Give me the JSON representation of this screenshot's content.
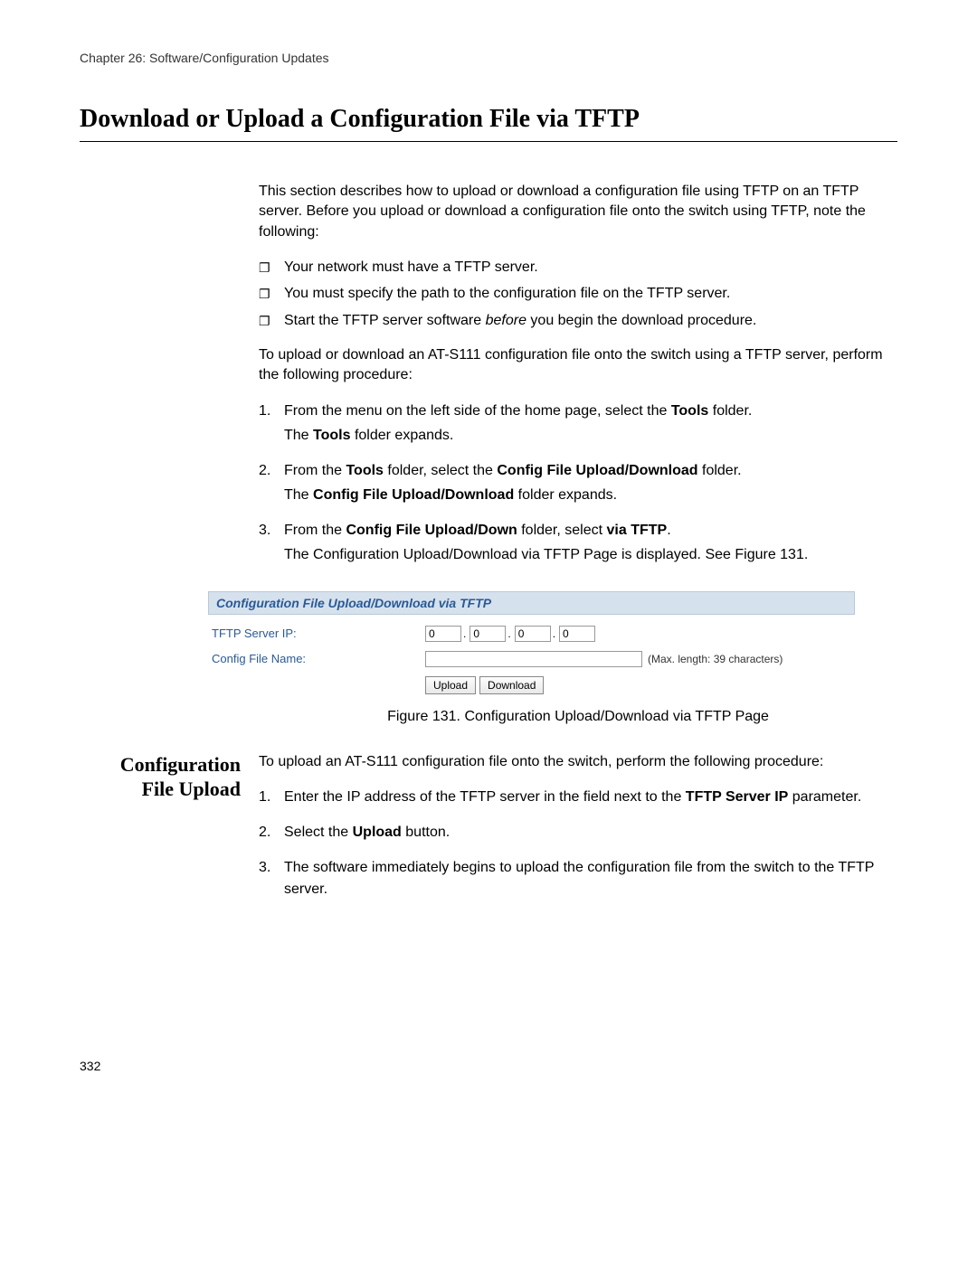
{
  "chapter_header": "Chapter 26: Software/Configuration Updates",
  "main_title": "Download or Upload a Configuration File via TFTP",
  "intro_para": "This section describes how to upload or download a configuration file using TFTP on an TFTP server. Before you upload or download a configuration file onto the switch using TFTP, note the following:",
  "bullets": {
    "b1": "Your network must have a TFTP server.",
    "b2": "You must specify the path to the configuration file on the TFTP server.",
    "b3a": "Start the TFTP server software ",
    "b3b": "before",
    "b3c": " you begin the download procedure."
  },
  "lead_para": "To upload or download an AT-S111 configuration file onto the switch using a TFTP server, perform the following procedure:",
  "steps1": {
    "s1": {
      "num": "1.",
      "a": "From the menu on the left side of the home page, select the ",
      "b": "Tools",
      "c": " folder.",
      "d": "The ",
      "e": "Tools",
      "f": " folder expands."
    },
    "s2": {
      "num": "2.",
      "a": "From the ",
      "b": "Tools",
      "c": " folder, select the ",
      "d": "Config File Upload/Download",
      "e": " folder.",
      "f": "The ",
      "g": "Config File Upload/Download",
      "h": " folder expands."
    },
    "s3": {
      "num": "3.",
      "a": "From the ",
      "b": "Config File Upload/Down",
      "c": " folder, select ",
      "d": "via TFTP",
      "e": ".",
      "f": "The Configuration Upload/Download via TFTP Page is displayed. See Figure 131."
    }
  },
  "panel": {
    "header": "Configuration File Upload/Download via TFTP",
    "label_ip": "TFTP Server IP:",
    "label_name": "Config File Name:",
    "ip": {
      "o1": "0",
      "o2": "0",
      "o3": "0",
      "o4": "0"
    },
    "maxnote": "(Max. length: 39 characters)",
    "btn_upload": "Upload",
    "btn_download": "Download"
  },
  "fig_caption": "Figure 131. Configuration Upload/Download via TFTP Page",
  "side_heading_line1": "Configuration",
  "side_heading_line2": "File Upload",
  "upload_intro": "To upload an AT-S111 configuration file onto the switch, perform the following procedure:",
  "steps2": {
    "s1": {
      "num": "1.",
      "a": "Enter the IP address of the TFTP server in the field next to the ",
      "b": "TFTP Server IP",
      "c": " parameter."
    },
    "s2": {
      "num": "2.",
      "a": "Select the ",
      "b": "Upload",
      "c": " button."
    },
    "s3": {
      "num": "3.",
      "a": "The software immediately begins to upload the configuration file from the switch to the TFTP server."
    }
  },
  "page_number": "332"
}
